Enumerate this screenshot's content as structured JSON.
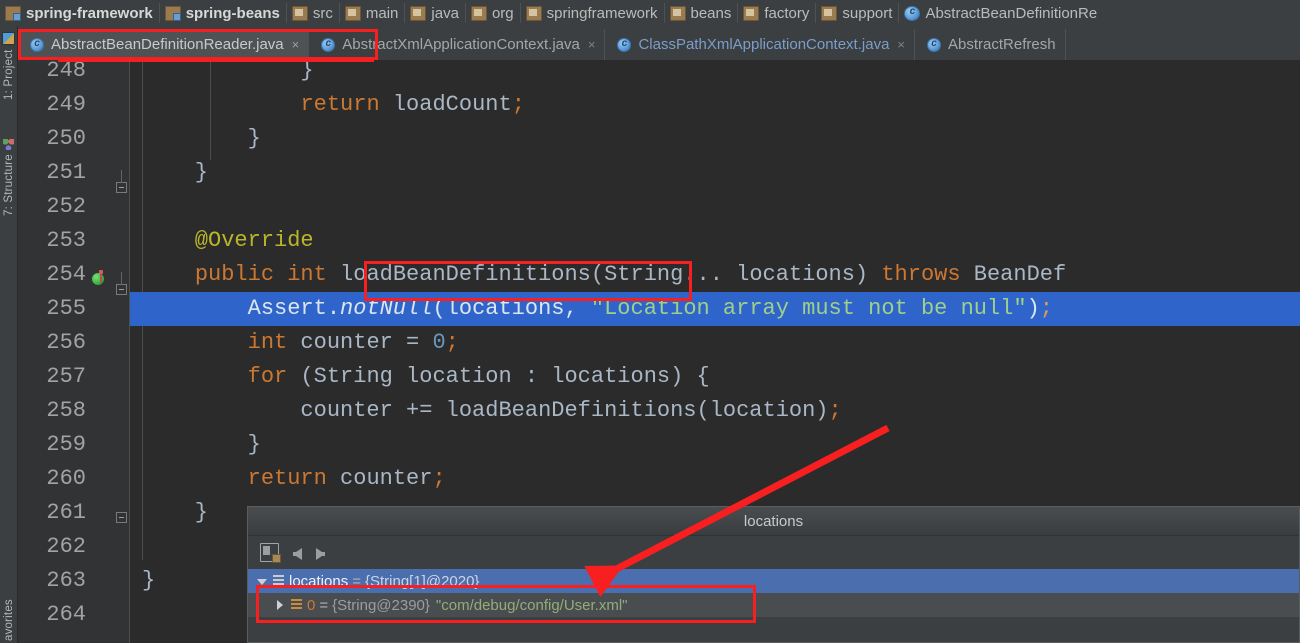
{
  "window": {
    "theme_bg": "#2b2b2b",
    "panel_bg": "#3c3f41",
    "accent_selection": "#2f65ca",
    "annotation_color": "#f71f1f"
  },
  "breadcrumb": {
    "items": [
      {
        "label": "spring-framework",
        "icon": "module-icon",
        "bold": true
      },
      {
        "label": "spring-beans",
        "icon": "module-icon",
        "bold": true
      },
      {
        "label": "src",
        "icon": "folder-icon",
        "bold": false
      },
      {
        "label": "main",
        "icon": "folder-icon",
        "bold": false
      },
      {
        "label": "java",
        "icon": "folder-icon",
        "bold": false
      },
      {
        "label": "org",
        "icon": "folder-icon",
        "bold": false
      },
      {
        "label": "springframework",
        "icon": "folder-icon",
        "bold": false
      },
      {
        "label": "beans",
        "icon": "folder-icon",
        "bold": false
      },
      {
        "label": "factory",
        "icon": "folder-icon",
        "bold": false
      },
      {
        "label": "support",
        "icon": "folder-icon",
        "bold": false
      },
      {
        "label": "AbstractBeanDefinitionRe",
        "icon": "java-class-icon",
        "bold": false
      }
    ]
  },
  "tabs": {
    "close_glyph": "×",
    "items": [
      {
        "label": "AbstractBeanDefinitionReader.java",
        "active": true,
        "blue": false
      },
      {
        "label": "AbstractXmlApplicationContext.java",
        "active": false,
        "blue": false
      },
      {
        "label": "ClassPathXmlApplicationContext.java",
        "active": false,
        "blue": true
      },
      {
        "label": "AbstractRefresh",
        "active": false,
        "blue": false
      }
    ]
  },
  "tool_strip": {
    "buttons": [
      {
        "label": "1: Project",
        "icon": "project-icon"
      },
      {
        "label": "7: Structure",
        "icon": "structure-icon"
      },
      {
        "label": "avorites",
        "icon": "none"
      }
    ]
  },
  "editor": {
    "line_numbers": [
      "248",
      "249",
      "250",
      "251",
      "252",
      "253",
      "254",
      "255",
      "256",
      "257",
      "258",
      "259",
      "260",
      "261",
      "262",
      "263",
      "264"
    ],
    "selected_line": "255",
    "breakpoint_line": "254",
    "lines": [
      {
        "n": "248",
        "tokens": [
          {
            "t": "            }",
            "c": "ident"
          }
        ]
      },
      {
        "n": "249",
        "tokens": [
          {
            "t": "            ",
            "c": "ident"
          },
          {
            "t": "return",
            "c": "kw"
          },
          {
            "t": " loadCount",
            "c": "ident"
          },
          {
            "t": ";",
            "c": "kw"
          }
        ]
      },
      {
        "n": "250",
        "tokens": [
          {
            "t": "        }",
            "c": "ident"
          }
        ]
      },
      {
        "n": "251",
        "tokens": [
          {
            "t": "    }",
            "c": "ident"
          }
        ]
      },
      {
        "n": "252",
        "tokens": [
          {
            "t": "",
            "c": "ident"
          }
        ]
      },
      {
        "n": "253",
        "tokens": [
          {
            "t": "    @Override",
            "c": "anno"
          }
        ]
      },
      {
        "n": "254",
        "tokens": [
          {
            "t": "    ",
            "c": "ident"
          },
          {
            "t": "public",
            "c": "kw"
          },
          {
            "t": " ",
            "c": "ident"
          },
          {
            "t": "int",
            "c": "kw"
          },
          {
            "t": " loadBeanDefinitions",
            "c": "ident"
          },
          {
            "t": "(String... locations) ",
            "c": "ident"
          },
          {
            "t": "throws",
            "c": "kw"
          },
          {
            "t": " BeanDef",
            "c": "ident"
          }
        ]
      },
      {
        "n": "255",
        "tokens": [
          {
            "t": "        Assert.",
            "c": "ident"
          },
          {
            "t": "notNull",
            "c": "static-it"
          },
          {
            "t": "(locations, ",
            "c": "ident"
          },
          {
            "t": "\"Location array must not be null\"",
            "c": "str"
          },
          {
            "t": ")",
            "c": "ident"
          },
          {
            "t": ";",
            "c": "kw"
          }
        ]
      },
      {
        "n": "256",
        "tokens": [
          {
            "t": "        ",
            "c": "ident"
          },
          {
            "t": "int",
            "c": "kw"
          },
          {
            "t": " counter = ",
            "c": "ident"
          },
          {
            "t": "0",
            "c": "num"
          },
          {
            "t": ";",
            "c": "kw"
          }
        ]
      },
      {
        "n": "257",
        "tokens": [
          {
            "t": "        ",
            "c": "ident"
          },
          {
            "t": "for",
            "c": "kw"
          },
          {
            "t": " (String location : locations) {",
            "c": "ident"
          }
        ]
      },
      {
        "n": "258",
        "tokens": [
          {
            "t": "            counter += loadBeanDefinitions(location)",
            "c": "ident"
          },
          {
            "t": ";",
            "c": "kw"
          }
        ]
      },
      {
        "n": "259",
        "tokens": [
          {
            "t": "        }",
            "c": "ident"
          }
        ]
      },
      {
        "n": "260",
        "tokens": [
          {
            "t": "        ",
            "c": "ident"
          },
          {
            "t": "return",
            "c": "kw"
          },
          {
            "t": " counter",
            "c": "ident"
          },
          {
            "t": ";",
            "c": "kw"
          }
        ]
      },
      {
        "n": "261",
        "tokens": [
          {
            "t": "    }",
            "c": "ident"
          }
        ]
      },
      {
        "n": "262",
        "tokens": [
          {
            "t": "",
            "c": "ident"
          }
        ]
      },
      {
        "n": "263",
        "tokens": [
          {
            "t": "}",
            "c": "ident"
          }
        ]
      },
      {
        "n": "264",
        "tokens": [
          {
            "t": "",
            "c": "ident"
          }
        ]
      }
    ]
  },
  "debug_popup": {
    "title": "locations",
    "toolbar_icons": [
      "add-to-watches-icon",
      "back-arrow-icon",
      "forward-arrow-icon"
    ],
    "tree": [
      {
        "expander": "down",
        "icon": "array-variable-icon",
        "name": "locations",
        "eq": "=",
        "type": "{String[1]@2020}",
        "value": "",
        "selected": true
      },
      {
        "expander": "right",
        "icon": "array-element-icon",
        "name": "0",
        "eq": "=",
        "type": "{String@2390}",
        "value": "\"com/debug/config/User.xml\"",
        "selected": false
      }
    ]
  },
  "annotations": {
    "boxes": [
      {
        "name": "tab-highlight-box"
      },
      {
        "name": "method-name-highlight-box"
      },
      {
        "name": "array-element-highlight-box"
      }
    ],
    "arrows": [
      {
        "name": "pointer-arrow-to-locations-variable"
      }
    ]
  }
}
